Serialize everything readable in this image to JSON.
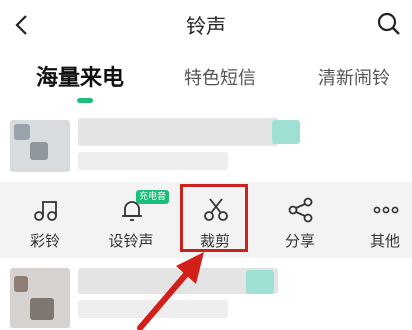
{
  "header": {
    "title": "铃声",
    "back_icon": "chevron-left-icon",
    "search_icon": "search-icon"
  },
  "tabs": [
    {
      "label": "海量来电",
      "active": true
    },
    {
      "label": "特色短信",
      "active": false
    },
    {
      "label": "清新闹铃",
      "active": false
    }
  ],
  "actions": [
    {
      "label": "彩铃",
      "icon": "music-note-icon"
    },
    {
      "label": "设铃声",
      "icon": "bell-icon",
      "badge": "充电音"
    },
    {
      "label": "裁剪",
      "icon": "scissors-icon"
    },
    {
      "label": "分享",
      "icon": "share-icon"
    },
    {
      "label": "其他",
      "icon": "more-icon"
    }
  ],
  "colors": {
    "accent": "#1bbf7a",
    "highlight": "#c8241d"
  }
}
